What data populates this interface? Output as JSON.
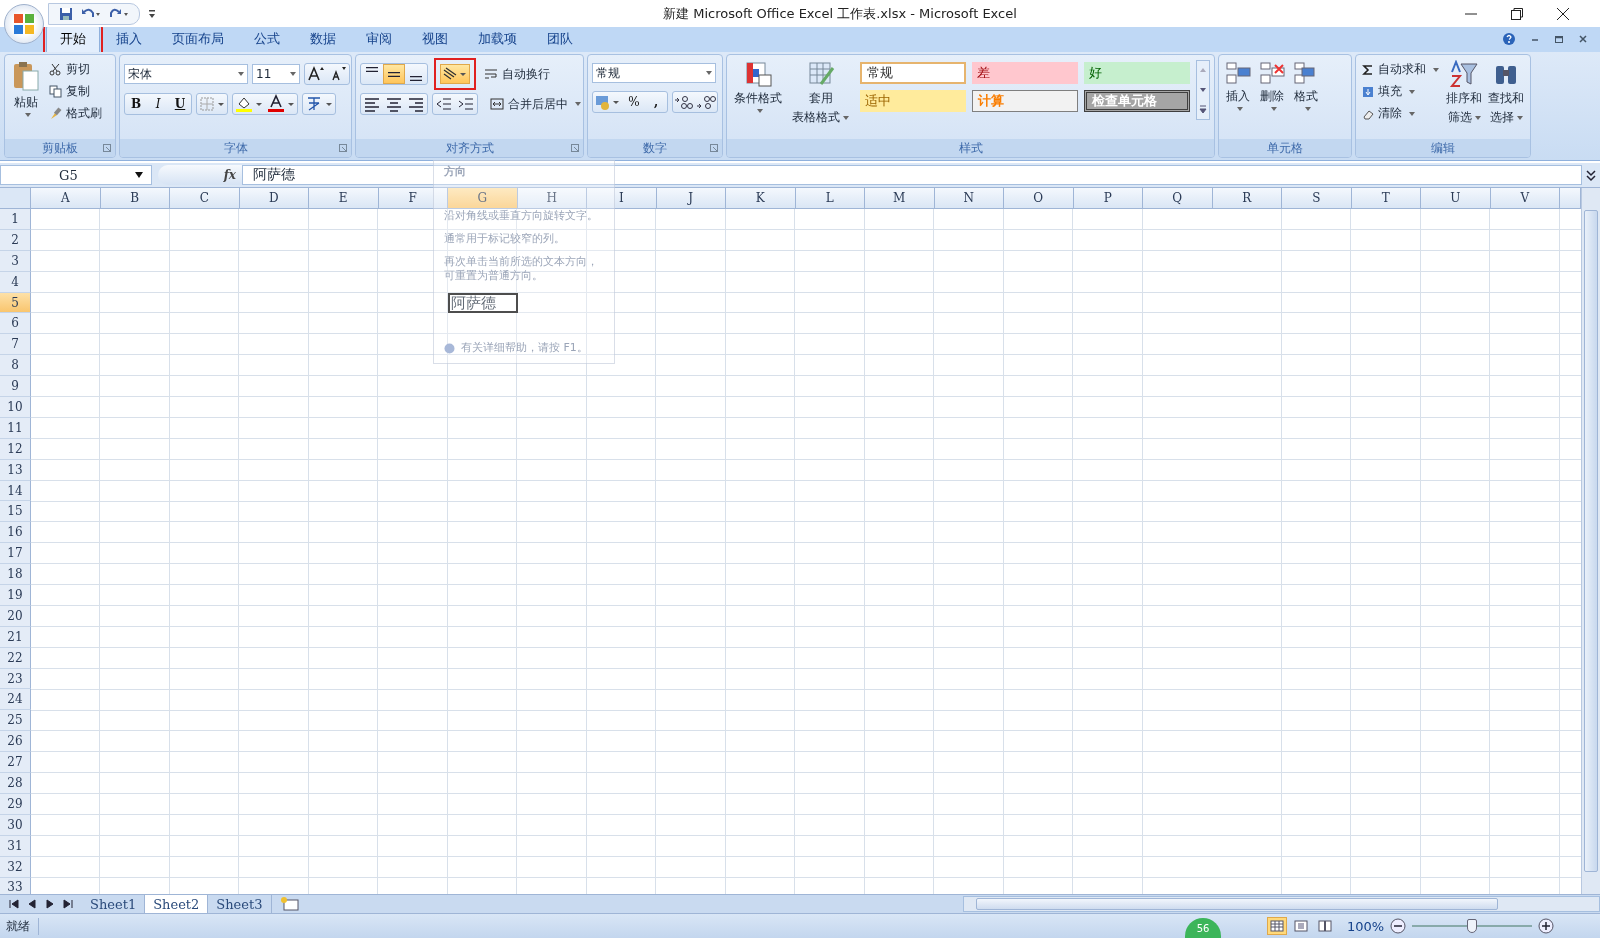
{
  "title_bar": {
    "title": "新建 Microsoft Office Excel 工作表.xlsx - Microsoft Excel"
  },
  "ribbon_tabs": [
    {
      "label": "开始",
      "selected": true,
      "annotated": true
    },
    {
      "label": "插入",
      "selected": false,
      "annotated": false
    },
    {
      "label": "页面布局",
      "selected": false,
      "annotated": false
    },
    {
      "label": "公式",
      "selected": false,
      "annotated": false
    },
    {
      "label": "数据",
      "selected": false,
      "annotated": false
    },
    {
      "label": "审阅",
      "selected": false,
      "annotated": false
    },
    {
      "label": "视图",
      "selected": false,
      "annotated": false
    },
    {
      "label": "加载项",
      "selected": false,
      "annotated": false
    },
    {
      "label": "团队",
      "selected": false,
      "annotated": false
    }
  ],
  "clipboard": {
    "label": "剪贴板",
    "paste": "粘贴",
    "commands": [
      "剪切",
      "复制",
      "格式刷"
    ]
  },
  "font": {
    "label": "字体",
    "family": "宋体",
    "size": "11",
    "bold": "B",
    "italic": "I",
    "underline": "U"
  },
  "alignment": {
    "label": "对齐方式",
    "vertical": [
      {
        "selected": false
      },
      {
        "selected": true
      },
      {
        "selected": false
      }
    ],
    "orientation": {
      "selected": true,
      "annotated": true
    },
    "wrap": "自动换行",
    "merge": "合并后居中"
  },
  "number": {
    "label": "数字",
    "format": "常规",
    "percent": "%",
    "comma": ","
  },
  "styles": {
    "label": "样式",
    "conditional": "条件格式",
    "table_1": "套用",
    "table_2": "表格格式",
    "gallery": [
      {
        "label": "常规",
        "kind": "normal"
      },
      {
        "label": "差",
        "kind": "bad"
      },
      {
        "label": "好",
        "kind": "good"
      },
      {
        "label": "适中",
        "kind": "neutral"
      },
      {
        "label": "计算",
        "kind": "calc"
      },
      {
        "label": "检查单元格",
        "kind": "check"
      }
    ]
  },
  "cells": {
    "label": "单元格",
    "commands": [
      "插入",
      "删除",
      "格式"
    ]
  },
  "editing": {
    "label": "编辑",
    "autosum": "自动求和",
    "fill": "填充",
    "clear": "清除",
    "sort_1": "排序和",
    "sort_2": "筛选",
    "find_1": "查找和",
    "find_2": "选择"
  },
  "formula_bar": {
    "name_box": "G5",
    "fx": "fx",
    "value": "阿萨德"
  },
  "columns": [
    "A",
    "B",
    "C",
    "D",
    "E",
    "F",
    "G",
    "H",
    "I",
    "J",
    "K",
    "L",
    "M",
    "N",
    "O",
    "P",
    "Q",
    "R",
    "S",
    "T",
    "U",
    "V"
  ],
  "rows": [
    {
      "label": "1"
    },
    {
      "label": "2"
    },
    {
      "label": "3"
    },
    {
      "label": "4"
    },
    {
      "label": "5",
      "cells": [
        null,
        null,
        null,
        null,
        null,
        null,
        {
          "value": "阿萨德",
          "selected": true
        }
      ]
    },
    {
      "label": "6"
    },
    {
      "label": "7"
    },
    {
      "label": "8"
    },
    {
      "label": "9"
    },
    {
      "label": "10"
    },
    {
      "label": "11"
    },
    {
      "label": "12"
    },
    {
      "label": "13"
    },
    {
      "label": "14"
    },
    {
      "label": "15"
    },
    {
      "label": "16"
    },
    {
      "label": "17"
    },
    {
      "label": "18"
    },
    {
      "label": "19"
    },
    {
      "label": "20"
    },
    {
      "label": "21"
    },
    {
      "label": "22"
    },
    {
      "label": "23"
    },
    {
      "label": "24"
    },
    {
      "label": "25"
    },
    {
      "label": "26"
    },
    {
      "label": "27"
    },
    {
      "label": "28"
    },
    {
      "label": "29"
    },
    {
      "label": "30"
    },
    {
      "label": "31"
    },
    {
      "label": "32"
    },
    {
      "label": "33"
    }
  ],
  "tooltip": {
    "title": "方向",
    "paragraphs": [
      "沿对角线或垂直方向旋转文字。",
      "通常用于标记较窄的列。",
      "再次单击当前所选的文本方向，可重置为普通方向。"
    ],
    "help": "有关详细帮助，请按 F1。"
  },
  "sheet_tabs": [
    {
      "label": "Sheet1",
      "selected": false
    },
    {
      "label": "Sheet2",
      "selected": true
    },
    {
      "label": "Sheet3",
      "selected": false
    }
  ],
  "status_bar": {
    "ready": "就绪",
    "badge": "56",
    "views": [
      {
        "selected": true
      },
      {
        "selected": false
      },
      {
        "selected": false
      }
    ],
    "zoom": "100%",
    "zoom_level": {
      "level": 0.5
    }
  }
}
